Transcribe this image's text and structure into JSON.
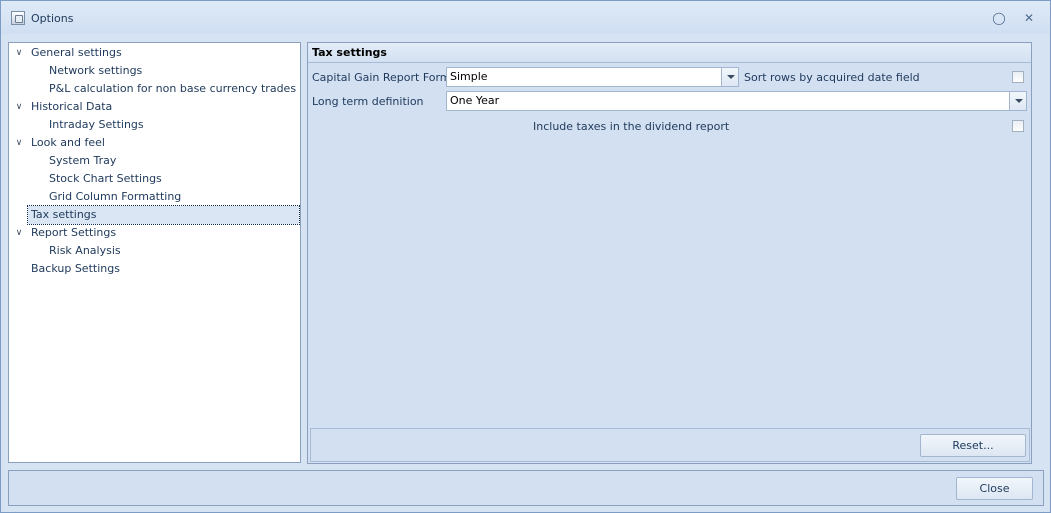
{
  "window": {
    "title": "Options",
    "icons": {
      "app": "app-options-icon",
      "pin": "pin-icon",
      "close": "close-icon"
    }
  },
  "tree": {
    "items": [
      {
        "label": "General settings",
        "level": 0,
        "expanded": true
      },
      {
        "label": "Network settings",
        "level": 1
      },
      {
        "label": "P&L calculation for non base currency trades",
        "level": 1
      },
      {
        "label": "Historical Data",
        "level": 0,
        "expanded": true
      },
      {
        "label": "Intraday Settings",
        "level": 1
      },
      {
        "label": "Look and feel",
        "level": 0,
        "expanded": true
      },
      {
        "label": "System Tray",
        "level": 1
      },
      {
        "label": "Stock Chart Settings",
        "level": 1
      },
      {
        "label": "Grid Column Formatting",
        "level": 1
      },
      {
        "label": "Tax settings",
        "level": 0,
        "selected": true
      },
      {
        "label": "Report Settings",
        "level": 0,
        "expanded": true
      },
      {
        "label": "Risk Analysis",
        "level": 1
      },
      {
        "label": "Backup Settings",
        "level": 0
      }
    ]
  },
  "tax": {
    "header": "Tax settings",
    "capital_gain_label": "Capital Gain Report Format",
    "capital_gain_value": "Simple",
    "sort_rows_label": "Sort rows by acquired date field",
    "sort_rows_checked": false,
    "long_term_label": "Long term definition",
    "long_term_value": "One Year",
    "include_taxes_label": "Include taxes in the dividend report",
    "include_taxes_checked": false,
    "reset_label": "Reset..."
  },
  "footer": {
    "close_label": "Close"
  },
  "colors": {
    "accent": "#1e395b",
    "panel": "#d3e0f1",
    "border": "#8ba0bc"
  }
}
